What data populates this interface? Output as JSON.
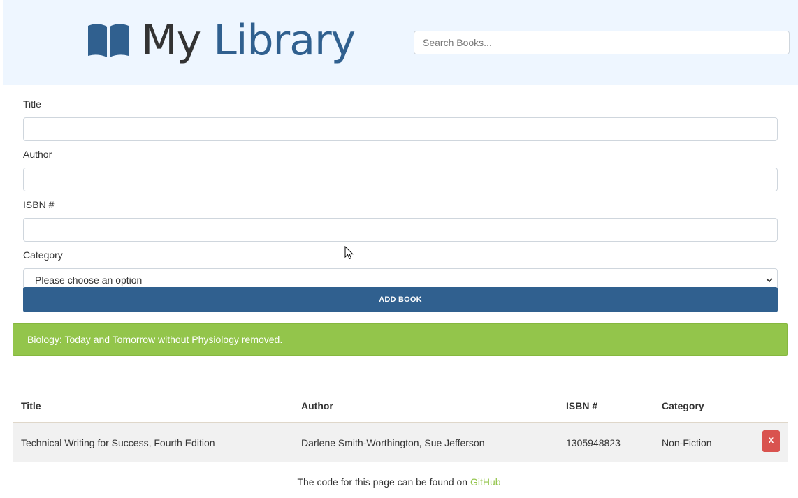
{
  "header": {
    "brand_part1": "My",
    "brand_part2": "Library",
    "search_placeholder": "Search Books..."
  },
  "form": {
    "title_label": "Title",
    "author_label": "Author",
    "isbn_label": "ISBN #",
    "category_label": "Category",
    "category_selected": "Please choose an option",
    "submit_label": "ADD BOOK"
  },
  "alert": {
    "message": "Biology: Today and Tomorrow without Physiology removed."
  },
  "table": {
    "columns": [
      "Title",
      "Author",
      "ISBN #",
      "Category"
    ],
    "rows": [
      {
        "title": "Technical Writing for Success, Fourth Edition",
        "author": "Darlene Smith-Worthington, Sue Jefferson",
        "isbn": "1305948823",
        "category": "Non-Fiction",
        "delete_label": "X"
      }
    ]
  },
  "footer": {
    "text": "The code for this page can be found on ",
    "link_text": "GitHub"
  },
  "colors": {
    "primary": "#30608f",
    "success": "#93c54b",
    "danger": "#d9534f",
    "header_bg": "#eef6ff"
  },
  "icons": {
    "brand": "book-open-icon",
    "select": "chevron-down-icon",
    "cursor": "mouse-cursor-icon"
  }
}
